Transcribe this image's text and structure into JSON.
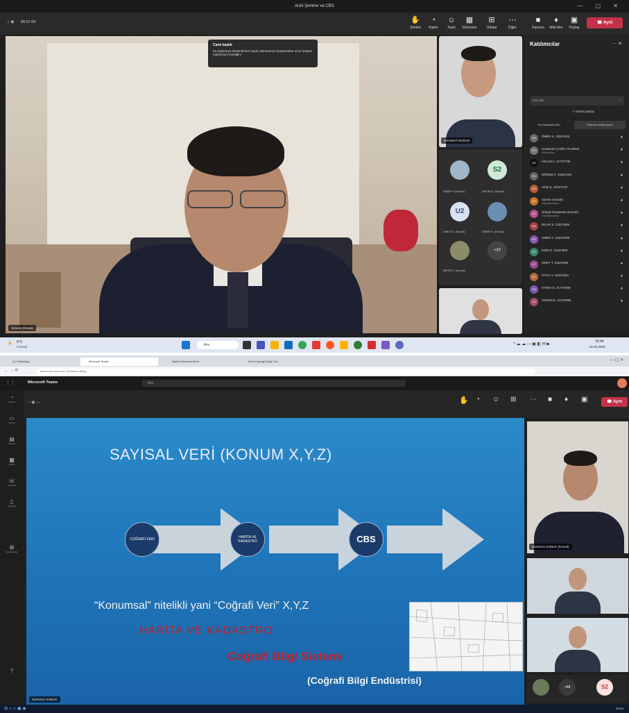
{
  "top": {
    "window_title": "Ardıl Şehirler ve CBS",
    "meeting_time": "00:57:06",
    "toolbar": [
      {
        "label": "Sohbet",
        "icon": "chat-icon"
      },
      {
        "label": "Kişiler",
        "icon": "people-icon"
      },
      {
        "label": "Tepki",
        "icon": "react-icon"
      },
      {
        "label": "Görünüm",
        "icon": "view-icon"
      },
      {
        "label": "Odalar",
        "icon": "rooms-icon"
      },
      {
        "label": "Diğer",
        "icon": "more-icon"
      },
      {
        "label": "Kamera",
        "icon": "camera-icon"
      },
      {
        "label": "Mikrofon",
        "icon": "mic-icon"
      },
      {
        "label": "Paylaş",
        "icon": "share-icon"
      }
    ],
    "leave_label": "Ayrıl",
    "notification": {
      "title": "Canlı başlık",
      "text": "Bu toplantıya katılanlardan kaydı izlememeye başlamadan önce müşteri toplantısını istediğini"
    },
    "main_name": "Sunucu (Konuk)",
    "small_names": {
      "top_right": "MAHMUT DOĞAN",
      "g1": "ADEM Y. (Konuk)",
      "g2": "SELİM G. (Konuk)",
      "g3": "UMUT S. (Konuk)",
      "g4": "ÖMER K. (Konuk)",
      "g5": "BEKİR E. (Konuk)",
      "avatar_s2": "S2",
      "avatar_u2": "U2",
      "more": "+37"
    },
    "participants_panel": {
      "title": "Katılımcılar",
      "search_placeholder": "Kişi ekle",
      "share_label": "Daveti paylaş",
      "tab_active": "Bu toplantıda (54)",
      "tab_other": "Herkese sessiz yapın",
      "rows": [
        {
          "initials": "ÖK",
          "name": "ÖMER K. 22537002",
          "sub": "",
          "color": "#6b6b6b"
        },
        {
          "initials": "CY",
          "name": "COSKUN ÇAĞRI YILDIRIZ",
          "sub": "Düzenleyici",
          "color": "#777"
        },
        {
          "initials": "AS",
          "name": "ASLAN A. 21727796",
          "sub": "",
          "color": "#111"
        },
        {
          "initials": "EK",
          "name": "ERDEM K. 21537425",
          "sub": "",
          "color": "#666"
        },
        {
          "initials": "AS",
          "name": "AKIŞ Ş. 21537219",
          "sub": "",
          "color": "#b45f3d"
        },
        {
          "initials": "AY",
          "name": "Aymen (Konuk)",
          "sub": "Doğrulanmamış",
          "color": "#c9752e"
        },
        {
          "initials": "CK",
          "name": "cihngiz kocaaman (Konuk)",
          "sub": "Doğrulanmamış",
          "color": "#b8508c"
        },
        {
          "initials": "DD",
          "name": "DILAN S. 21537909",
          "sub": "",
          "color": "#a84444"
        },
        {
          "initials": "OE",
          "name": "OMER A. 21537909",
          "sub": "",
          "color": "#8a5ab0"
        },
        {
          "initials": "EE",
          "name": "ESİN E. 21537800",
          "sub": "",
          "color": "#3b8a6c"
        },
        {
          "initials": "OT",
          "name": "ONEY T. 21537801",
          "sub": "",
          "color": "#9c4a8f"
        },
        {
          "initials": "OY",
          "name": "OYKU Y. 21537804",
          "sub": "",
          "color": "#b06a3d"
        },
        {
          "initials": "FA",
          "name": "FATMA E. 21737808",
          "sub": "",
          "color": "#7a5ab0"
        },
        {
          "initials": "CE",
          "name": "CEREN E. 21737895",
          "sub": "",
          "color": "#a44a6d"
        }
      ]
    },
    "taskbar": {
      "weather_temp": "5°C",
      "weather_desc": "Güneşli",
      "search": "Ara",
      "clock_time": "15:44",
      "clock_date": "21.02.2025"
    }
  },
  "bottom": {
    "browser_tabs": [
      "(1) WhatsApp",
      "Microsoft Teams",
      "Egitim Microsoft Word",
      "Ders Kaynagi Dijital Veri"
    ],
    "address": "teams.microsoft.com/_#/modern-calling",
    "teams_title": "Microsoft Teams",
    "teams_search": "Ara",
    "leave_label": "Ayrıl",
    "rail": [
      "Etkinlik",
      "Sohbet",
      "Takımlar",
      "Takvim",
      "Aramalar",
      "Dosyalar",
      "Uygulamalar"
    ],
    "slide": {
      "title": "SAYISAL VERİ (KONUM X,Y,Z)",
      "circle1": "COĞRAFİ VERİ",
      "circle2": "HARİTA VE KADASTRO",
      "circle3": "CBS",
      "line1": "“Konumsal” nitelikli yani “Coğrafi Veri” X,Y,Z",
      "line2": "HARİTA VE KADASTRO",
      "line3": "Coğrafi Bilgi Sistemi",
      "line4": "(Coğrafi Bilgi Endüstrisi)"
    },
    "presenter_name": "SUNUCU KONUK",
    "right_video_name": "SUNUCU KONUK (Konuk)",
    "avatar_s2": "S2",
    "more": "+48",
    "taskbar_time": "15:44"
  }
}
